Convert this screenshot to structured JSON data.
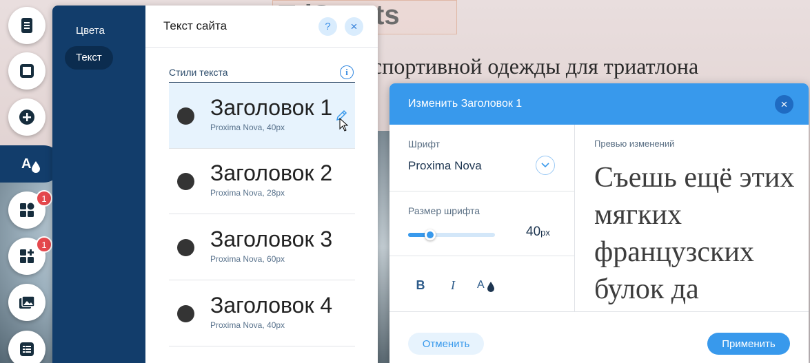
{
  "background": {
    "logo_text": "TriSports",
    "heading": "спортивной одежды для триатлона"
  },
  "rail": {
    "items": [
      {
        "icon": "pages-icon"
      },
      {
        "icon": "background-icon"
      },
      {
        "icon": "add-icon"
      },
      {
        "icon": "theme-icon",
        "active": true
      },
      {
        "icon": "app-market-icon",
        "badge": "1"
      },
      {
        "icon": "add-apps-icon",
        "badge": "1"
      },
      {
        "icon": "media-icon"
      },
      {
        "icon": "data-icon"
      }
    ]
  },
  "theme_panel": {
    "nav": {
      "colors": "Цвета",
      "text": "Текст"
    },
    "title": "Текст сайта",
    "help_symbol": "?",
    "close_symbol": "×",
    "section_label": "Стили текста",
    "info_symbol": "i",
    "styles": [
      {
        "name": "Заголовок 1",
        "font": "Proxima Nova, 40px",
        "selected": true
      },
      {
        "name": "Заголовок 2",
        "font": "Proxima Nova, 28px"
      },
      {
        "name": "Заголовок 3",
        "font": "Proxima Nova, 60px"
      },
      {
        "name": "Заголовок 4",
        "font": "Proxima Nova, 40px"
      }
    ]
  },
  "edit_dialog": {
    "title": "Изменить Заголовок 1",
    "close_symbol": "×",
    "font_label": "Шрифт",
    "font_value": "Proxima Nova",
    "size_label": "Размер шрифта",
    "size_value": "40",
    "size_unit": "px",
    "size_slider_fraction": 0.25,
    "bold_label": "B",
    "italic_label": "I",
    "preview_label": "Превью изменений",
    "preview_text": "Съешь ещё этих мягких французских булок да",
    "cancel_label": "Отменить",
    "apply_label": "Применить"
  },
  "colors": {
    "accent": "#3899ec",
    "nav_dark": "#123d6b",
    "badge": "#e5484d"
  }
}
